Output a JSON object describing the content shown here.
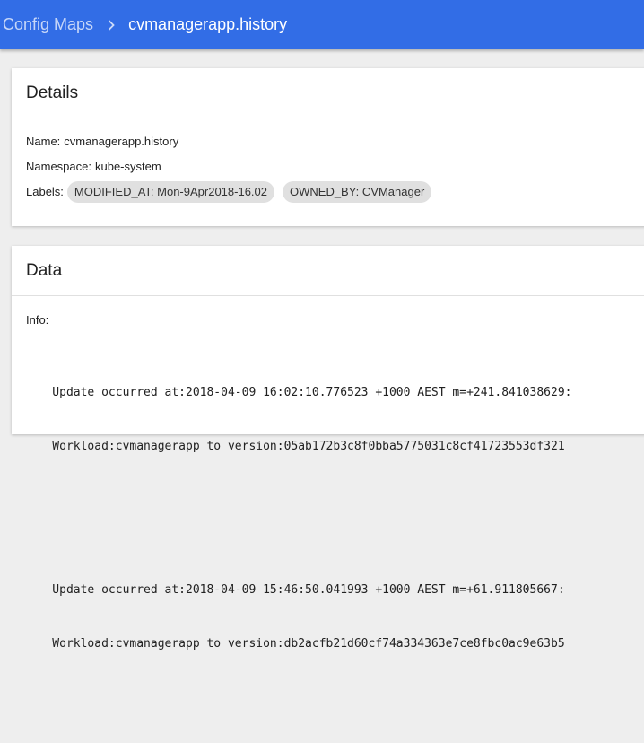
{
  "breadcrumb": {
    "parent": "Config Maps",
    "current": "cvmanagerapp.history"
  },
  "details": {
    "title": "Details",
    "name_label": "Name:",
    "name_value": "cvmanagerapp.history",
    "namespace_label": "Namespace:",
    "namespace_value": "kube-system",
    "labels_label": "Labels:",
    "labels": [
      "MODIFIED_AT: Mon-9Apr2018-16.02",
      "OWNED_BY: CVManager"
    ]
  },
  "data": {
    "title": "Data",
    "info_label": "Info:",
    "entries": [
      {
        "line1": "Update occurred at:2018-04-09 16:02:10.776523 +1000 AEST m=+241.841038629:",
        "line2": "Workload:cvmanagerapp to version:05ab172b3c8f0bba5775031c8cf41723553df321"
      },
      {
        "line1": "Update occurred at:2018-04-09 15:46:50.041993 +1000 AEST m=+61.911805667:",
        "line2": "Workload:cvmanagerapp to version:db2acfb21d60cf74a334363e7ce8fbc0ac9e63b5"
      }
    ]
  },
  "colors": {
    "topbar": "#326de6",
    "chip": "#e0e0e0",
    "background": "#eeeeee"
  }
}
